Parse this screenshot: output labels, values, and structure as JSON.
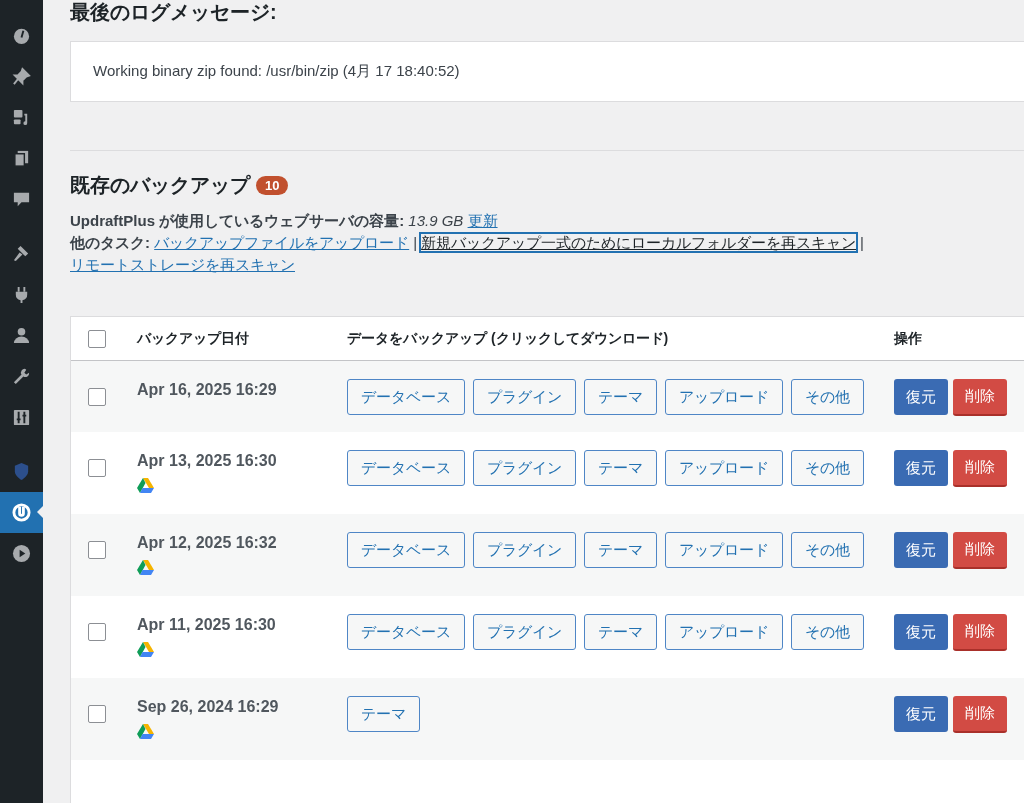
{
  "sidebar": {
    "groups": [
      [
        {
          "kind": "dashboard",
          "selected": false
        },
        {
          "kind": "pin",
          "selected": false
        },
        {
          "kind": "media",
          "selected": false
        },
        {
          "kind": "pages",
          "selected": false
        },
        {
          "kind": "comments",
          "selected": false
        }
      ],
      [
        {
          "kind": "appearance",
          "selected": false
        },
        {
          "kind": "plugins",
          "selected": false
        },
        {
          "kind": "users",
          "selected": false
        },
        {
          "kind": "tools",
          "selected": false
        },
        {
          "kind": "settings",
          "selected": false
        }
      ],
      [
        {
          "kind": "shield",
          "selected": false
        },
        {
          "kind": "updraft",
          "selected": true
        },
        {
          "kind": "play",
          "selected": false
        }
      ]
    ]
  },
  "log": {
    "heading": "最後のログメッセージ:",
    "message": "Working binary zip found: /usr/bin/zip (4月 17 18:40:52)"
  },
  "backups": {
    "heading": "既存のバックアップ",
    "count": "10",
    "usage": {
      "label": "UpdraftPlus が使用しているウェブサーバの容量:",
      "value": "13.9 GB",
      "link": "更新"
    },
    "tasks": {
      "label": "他のタスク:",
      "separator": "|",
      "links": [
        {
          "label": "バックアップファイルをアップロード",
          "focused": false
        },
        {
          "label": "新規バックアップ一式のためにローカルフォルダーを再スキャン",
          "focused": true
        },
        {
          "label": "リモートストレージを再スキャン",
          "focused": false
        }
      ]
    }
  },
  "table": {
    "select_all_checked": false,
    "columns": [
      "バックアップ日付",
      "データをバックアップ (クリックしてダウンロード)",
      "操作"
    ],
    "rows": [
      {
        "checked": false,
        "date": "Apr 16, 2025 16:29",
        "cloud": false,
        "files": [
          "データベース",
          "プラグイン",
          "テーマ",
          "アップロード",
          "その他"
        ],
        "actions": [
          {
            "label": "復元",
            "kind": "restore"
          },
          {
            "label": "削除",
            "kind": "delete"
          }
        ]
      },
      {
        "checked": false,
        "date": "Apr 13, 2025 16:30",
        "cloud": true,
        "files": [
          "データベース",
          "プラグイン",
          "テーマ",
          "アップロード",
          "その他"
        ],
        "actions": [
          {
            "label": "復元",
            "kind": "restore"
          },
          {
            "label": "削除",
            "kind": "delete"
          }
        ]
      },
      {
        "checked": false,
        "date": "Apr 12, 2025 16:32",
        "cloud": true,
        "files": [
          "データベース",
          "プラグイン",
          "テーマ",
          "アップロード",
          "その他"
        ],
        "actions": [
          {
            "label": "復元",
            "kind": "restore"
          },
          {
            "label": "削除",
            "kind": "delete"
          }
        ]
      },
      {
        "checked": false,
        "date": "Apr 11, 2025 16:30",
        "cloud": true,
        "files": [
          "データベース",
          "プラグイン",
          "テーマ",
          "アップロード",
          "その他"
        ],
        "actions": [
          {
            "label": "復元",
            "kind": "restore"
          },
          {
            "label": "削除",
            "kind": "delete"
          }
        ]
      },
      {
        "checked": false,
        "date": "Sep 26, 2024 16:29",
        "cloud": true,
        "files": [
          "テーマ"
        ],
        "actions": [
          {
            "label": "復元",
            "kind": "restore"
          },
          {
            "label": "削除",
            "kind": "delete"
          }
        ]
      }
    ]
  }
}
